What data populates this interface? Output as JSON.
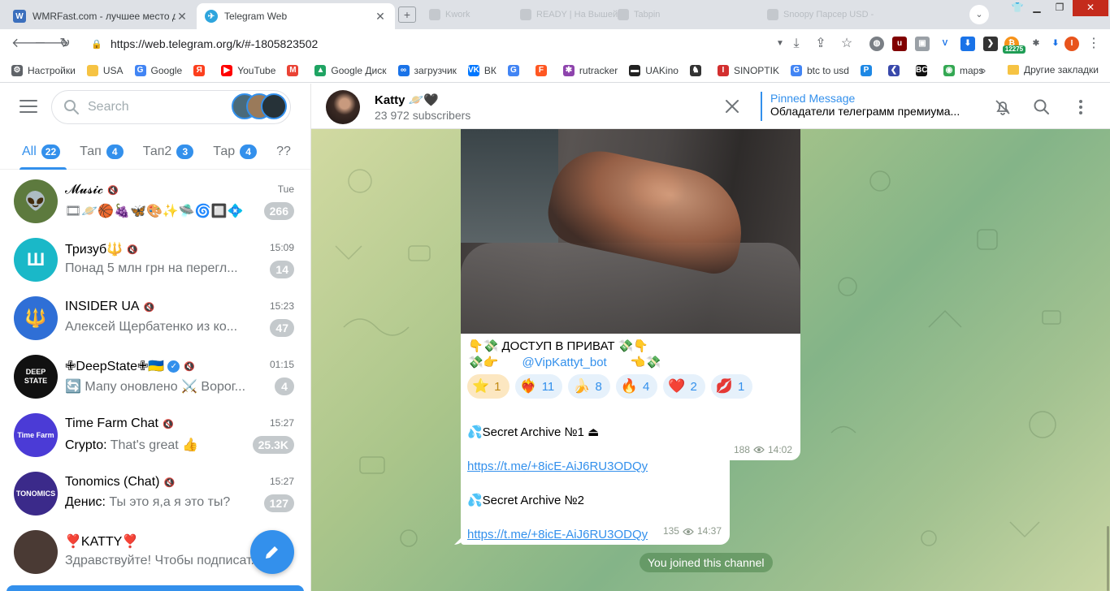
{
  "browser": {
    "tabs": [
      {
        "title": "WMRFast.com - лучшее место для",
        "favicon": "W",
        "favicon_color": "#3b6fbd"
      },
      {
        "title": "Telegram Web",
        "favicon": "✈",
        "favicon_color": "#2ea5dd"
      }
    ],
    "ghost_tabs": [
      "Kwork",
      "READY | На Вышей",
      "Tabpin",
      "Snoopy Парсер USD -"
    ],
    "url": "https://web.telegram.org/k/#-1805823502",
    "ext_counter": "12275",
    "bookmarks": [
      {
        "label": "Настройки",
        "color": "#5f6368",
        "glyph": "⚙"
      },
      {
        "label": "USA",
        "color": "#f6c343",
        "glyph": ""
      },
      {
        "label": "Google",
        "color": "#4285f4",
        "glyph": "G"
      },
      {
        "label": "",
        "color": "#fc3f1d",
        "glyph": "Я"
      },
      {
        "label": "YouTube",
        "color": "#ff0000",
        "glyph": "▶"
      },
      {
        "label": "",
        "color": "#ea4335",
        "glyph": "M"
      },
      {
        "label": "Google Диск",
        "color": "#1fa463",
        "glyph": "▲"
      },
      {
        "label": "загрузчик",
        "color": "#1a73e8",
        "glyph": "∞"
      },
      {
        "label": "ВК",
        "color": "#0077ff",
        "glyph": "VK"
      },
      {
        "label": "",
        "color": "#4285f4",
        "glyph": "G"
      },
      {
        "label": "",
        "color": "#ff5722",
        "glyph": "F"
      },
      {
        "label": "rutracker",
        "color": "#8e44ad",
        "glyph": "✱"
      },
      {
        "label": "UAKino",
        "color": "#222222",
        "glyph": "▬"
      },
      {
        "label": "",
        "color": "#333333",
        "glyph": "♞"
      },
      {
        "label": "SINOPTIK",
        "color": "#d32f2f",
        "glyph": "I"
      },
      {
        "label": "btc to usd",
        "color": "#4285f4",
        "glyph": "G"
      },
      {
        "label": "",
        "color": "#1e88e5",
        "glyph": "P"
      },
      {
        "label": "",
        "color": "#3949ab",
        "glyph": "❮"
      },
      {
        "label": "",
        "color": "#111111",
        "glyph": "BC"
      },
      {
        "label": "maps",
        "color": "#34a853",
        "glyph": "◉"
      }
    ],
    "bookmarks_more": "»",
    "other_bookmarks": "Другие закладки"
  },
  "sidebar": {
    "search_placeholder": "Search",
    "folders": [
      {
        "label": "All",
        "count": "22",
        "active": true
      },
      {
        "label": "Тап",
        "count": "4"
      },
      {
        "label": "Тап2",
        "count": "3"
      },
      {
        "label": "Тар",
        "count": "4"
      },
      {
        "label": "??",
        "count": ""
      }
    ],
    "chats": [
      {
        "name": "𝓜𝓾𝓼𝓲𝓬",
        "time": "Tue",
        "preview_sender": "",
        "preview": "🎞🪐🏀🍇🦋🎨✨🛸🌀🔲💠",
        "badge": "266",
        "muted": true,
        "avatar_color": "#5d7a3e",
        "avatar_text": "👽"
      },
      {
        "name": "Тризуб🔱",
        "time": "15:09",
        "preview_sender": "",
        "preview": "Понад 5 млн грн на перегл...",
        "badge": "14",
        "muted": true,
        "avatar_color": "#1ab8c8",
        "avatar_text": "Ш"
      },
      {
        "name": "INSIDER UA",
        "time": "15:23",
        "preview_sender": "",
        "preview": "Алексей Щербатенко из ко...",
        "badge": "47",
        "muted": true,
        "avatar_color": "#2f6fd6",
        "avatar_text": "🔱"
      },
      {
        "name": "✙DeepState✙🇺🇦",
        "time": "01:15",
        "preview_sender": "",
        "preview": "🔄 Мапу оновлено ⚔️ Ворог...",
        "badge": "4",
        "muted": true,
        "verified": true,
        "avatar_color": "#111111",
        "avatar_text": "DEEP STATE"
      },
      {
        "name": "Time Farm Chat",
        "time": "15:27",
        "preview_sender": "Crypto:",
        "preview": "That's great 👍",
        "badge": "25.3K",
        "muted": true,
        "avatar_color": "#4b3bd6",
        "avatar_text": "Time Farm"
      },
      {
        "name": "Tonomics (Chat)",
        "time": "15:27",
        "preview_sender": "Денис:",
        "preview": "Ты это я,а я это ты?",
        "badge": "127",
        "muted": true,
        "avatar_color": "#3b2a8a",
        "avatar_text": "TONOMICS"
      },
      {
        "name": "❣️KATTY❣️",
        "time": "",
        "preview_sender": "",
        "preview": "Здравствуйте! Чтобы подписат...",
        "badge": "",
        "muted": false,
        "avatar_color": "#4a3a34",
        "avatar_text": ""
      }
    ]
  },
  "channel": {
    "name": "Katty 🪐🖤",
    "subscribers": "23 972 subscribers",
    "pinned_title": "Pinned Message",
    "pinned_text": "Обладатели телеграмм премиума..."
  },
  "messages": {
    "photo_caption_line1": "👇💸  ДОСТУП В ПРИВАТ  💸👇",
    "photo_caption_line2_prefix": "💸👉",
    "photo_caption_link": "@VipKattyt_bot",
    "photo_caption_line2_suffix": "👈💸",
    "reactions": [
      {
        "emoji": "⭐",
        "count": "1",
        "chosen": true
      },
      {
        "emoji": "❤️‍🔥",
        "count": "11"
      },
      {
        "emoji": "🍌",
        "count": "8"
      },
      {
        "emoji": "🔥",
        "count": "4"
      },
      {
        "emoji": "❤️",
        "count": "2"
      },
      {
        "emoji": "💋",
        "count": "1"
      }
    ],
    "photo_views": "188",
    "photo_time": "14:02",
    "archive1_title": "💦Secret Archive №1 ⏏",
    "archive1_link": "https://t.me/+8icE-AiJ6RU3ODQy",
    "archive2_title": "💦Secret Archive №2",
    "archive2_link": "https://t.me/+8icE-AiJ6RU3ODQy",
    "text_views": "135",
    "text_time": "14:37",
    "service": "You joined this channel"
  }
}
